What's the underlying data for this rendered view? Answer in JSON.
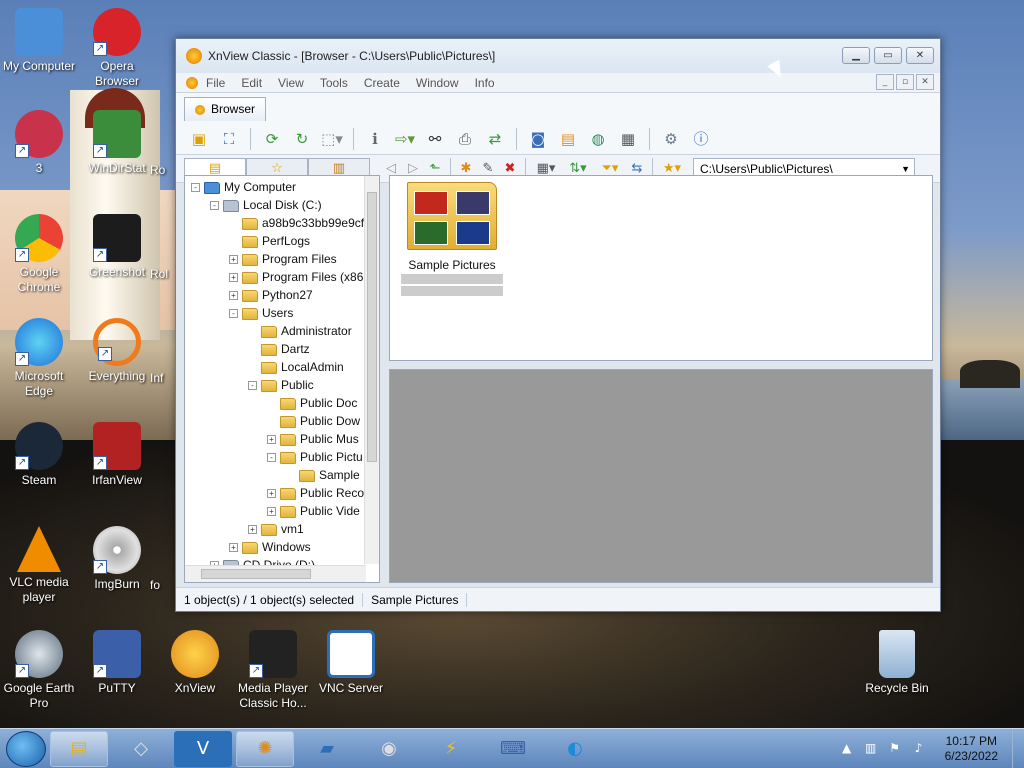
{
  "desktop": {
    "icons": [
      {
        "label": "My Computer",
        "color": "#4a8fd8"
      },
      {
        "label": "Opera Browser",
        "color": "#d8232a"
      },
      {
        "label": "3",
        "color": "#c8324a"
      },
      {
        "label": "WinDirStat",
        "color": "#3b8c3b"
      },
      {
        "label": "Google Chrome",
        "color": "#34a853"
      },
      {
        "label": "Greenshot",
        "color": "#1c1c1c"
      },
      {
        "label": "Microsoft Edge",
        "color": "#1f8ad8"
      },
      {
        "label": "Everything",
        "color": "#f07a1c"
      },
      {
        "label": "Steam",
        "color": "#1b2838"
      },
      {
        "label": "IrfanView",
        "color": "#b22222"
      },
      {
        "label": "VLC media player",
        "color": "#f08c00"
      },
      {
        "label": "ImgBurn",
        "color": "#8a8a8a"
      },
      {
        "label": "Google Earth Pro",
        "color": "#5a6b7c"
      },
      {
        "label": "PuTTY",
        "color": "#3b5fa8"
      },
      {
        "label": "XnView",
        "color": "#e08a1a"
      },
      {
        "label": "Media Player Classic Ho...",
        "color": "#222222"
      },
      {
        "label": "VNC Server",
        "color": "#2a6fb8"
      },
      {
        "label": "Recycle Bin",
        "color": "#5a87b8"
      }
    ],
    "partial_labels": [
      "Ro",
      "Rol",
      "Inf",
      "fo"
    ]
  },
  "window": {
    "title": "XnView Classic - [Browser - C:\\Users\\Public\\Pictures\\]",
    "menu": [
      "File",
      "Edit",
      "View",
      "Tools",
      "Create",
      "Window",
      "Info"
    ],
    "tab": "Browser",
    "address": "C:\\Users\\Public\\Pictures\\",
    "tree": [
      {
        "label": "My Computer",
        "level": 0,
        "exp": "-"
      },
      {
        "label": "Local Disk (C:)",
        "level": 1,
        "exp": "-"
      },
      {
        "label": "a98b9c33bb99e9cf",
        "level": 2,
        "exp": ""
      },
      {
        "label": "PerfLogs",
        "level": 2,
        "exp": ""
      },
      {
        "label": "Program Files",
        "level": 2,
        "exp": "+"
      },
      {
        "label": "Program Files (x86",
        "level": 2,
        "exp": "+"
      },
      {
        "label": "Python27",
        "level": 2,
        "exp": "+"
      },
      {
        "label": "Users",
        "level": 2,
        "exp": "-"
      },
      {
        "label": "Administrator",
        "level": 3,
        "exp": ""
      },
      {
        "label": "Dartz",
        "level": 3,
        "exp": ""
      },
      {
        "label": "LocalAdmin",
        "level": 3,
        "exp": ""
      },
      {
        "label": "Public",
        "level": 3,
        "exp": "-"
      },
      {
        "label": "Public Doc",
        "level": 4,
        "exp": ""
      },
      {
        "label": "Public Dow",
        "level": 4,
        "exp": ""
      },
      {
        "label": "Public Mus",
        "level": 4,
        "exp": "+"
      },
      {
        "label": "Public Pictu",
        "level": 4,
        "exp": "-"
      },
      {
        "label": "Sample",
        "level": 5,
        "exp": ""
      },
      {
        "label": "Public Reco",
        "level": 4,
        "exp": "+"
      },
      {
        "label": "Public Vide",
        "level": 4,
        "exp": "+"
      },
      {
        "label": "vm1",
        "level": 3,
        "exp": "+"
      },
      {
        "label": "Windows",
        "level": 2,
        "exp": "+"
      },
      {
        "label": "CD Drive (D:)",
        "level": 1,
        "exp": "+"
      }
    ],
    "files": [
      {
        "label": "Sample Pictures"
      }
    ],
    "status": [
      "1 object(s) / 1 object(s) selected",
      "Sample Pictures"
    ]
  },
  "taskbar": {
    "time": "10:17 PM",
    "date": "6/23/2022"
  }
}
